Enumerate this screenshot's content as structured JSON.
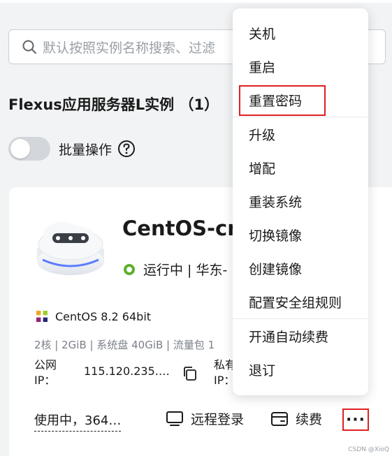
{
  "search": {
    "placeholder": "默认按照实例名称搜索、过滤"
  },
  "section": {
    "title": "Flexus应用服务器L实例 （1）"
  },
  "batch": {
    "label": "批量操作"
  },
  "instance": {
    "name": "CentOS-cn-",
    "status": "运行中 | 华东-",
    "os": "CentOS 8.2 64bit",
    "spec": "2核 | 2GiB | 系统盘 40GiB | 流量包 1",
    "public_ip_label": "公网\nIP：",
    "public_ip_value": "115.120.235.…",
    "private_ip_label": "私有\nIP：",
    "usage": "使用中，364…",
    "remote_login": "远程登录",
    "renew": "续费",
    "more": "···"
  },
  "menu": {
    "items": [
      "关机",
      "重启",
      "重置密码",
      "升级",
      "增配",
      "重装系统",
      "切换镜像",
      "创建镜像",
      "配置安全组规则",
      "开通自动续费",
      "退订"
    ]
  },
  "watermark": "CSDN @XioQ",
  "colors": {
    "highlight_border": "#e02020",
    "status_green": "#5cb02b"
  }
}
